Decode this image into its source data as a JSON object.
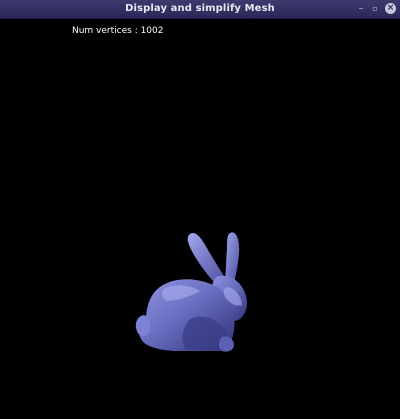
{
  "window": {
    "title": "Display and simplify Mesh",
    "controls": {
      "minimize": "–",
      "maximize": "▫",
      "close": "×"
    }
  },
  "viewport": {
    "background": "#000000",
    "info_text": "Num vertices : 1002",
    "mesh": {
      "name": "bunny-icon",
      "color": "#6a6fc2"
    }
  }
}
